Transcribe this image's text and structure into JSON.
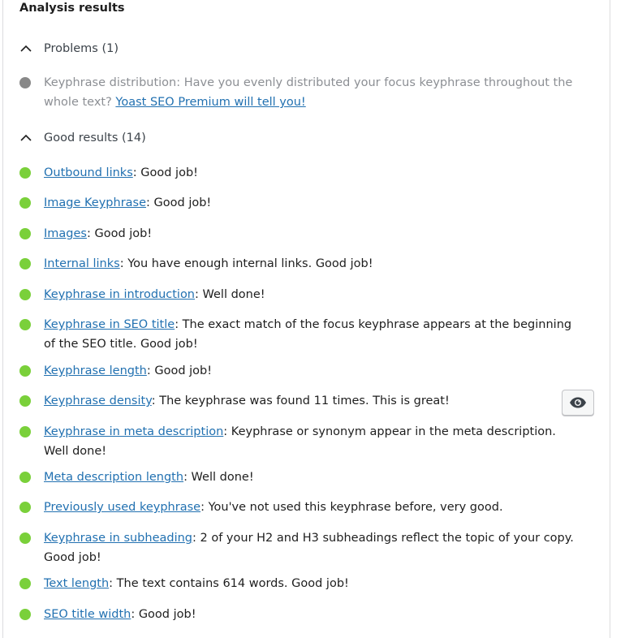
{
  "title": "Analysis results",
  "problems": {
    "label": "Problems (1)",
    "items": [
      {
        "status": "gray",
        "text": "Keyphrase distribution: Have you evenly distributed your focus keyphrase throughout the whole text? ",
        "link": "Yoast SEO Premium will tell you!"
      }
    ]
  },
  "good": {
    "label": "Good results (14)",
    "items": [
      {
        "link": "Outbound links",
        "text": ": Good job!"
      },
      {
        "link": "Image Keyphrase",
        "text": ": Good job!"
      },
      {
        "link": "Images",
        "text": ": Good job!"
      },
      {
        "link": "Internal links",
        "text": ": You have enough internal links. Good job!"
      },
      {
        "link": "Keyphrase in introduction",
        "text": ": Well done!"
      },
      {
        "link": "Keyphrase in SEO title",
        "text": ": The exact match of the focus keyphrase appears at the beginning of the SEO title. Good job!"
      },
      {
        "link": "Keyphrase length",
        "text": ": Good job!"
      },
      {
        "link": "Keyphrase density",
        "text": ": The keyphrase was found 11 times. This is great!"
      },
      {
        "link": "Keyphrase in meta description",
        "text": ": Keyphrase or synonym appear in the meta description. Well done!"
      },
      {
        "link": "Meta description length",
        "text": ": Well done!"
      },
      {
        "link": "Previously used keyphrase",
        "text": ": You've not used this keyphrase before, very good."
      },
      {
        "link": "Keyphrase in subheading",
        "text": ": 2 of your H2 and H3 subheadings reflect the topic of your copy. Good job!"
      },
      {
        "link": "Text length",
        "text": ": The text contains 614 words. Good job!"
      },
      {
        "link": "SEO title width",
        "text": ": Good job!"
      }
    ]
  },
  "colors": {
    "good": "#7ad03a",
    "problem": "#888888",
    "link": "#2271b1"
  },
  "icons": {
    "section_toggle": "chevron-up-icon",
    "highlight_button": "eye-icon"
  }
}
